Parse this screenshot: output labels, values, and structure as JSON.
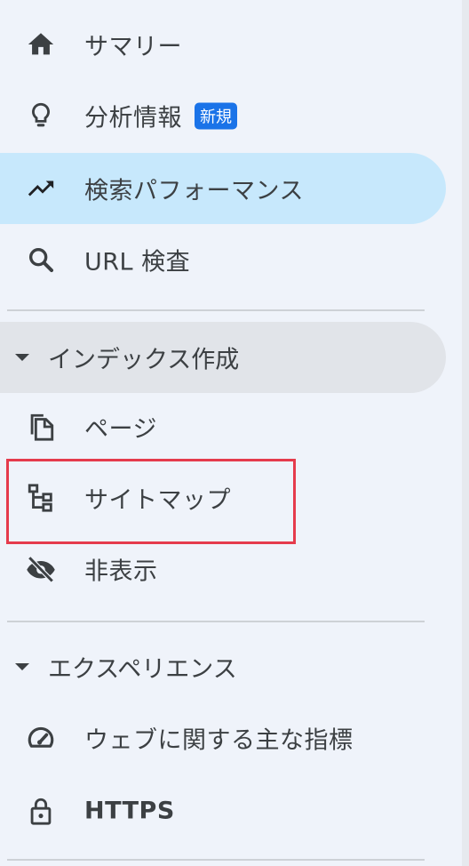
{
  "nav": {
    "summary": {
      "label": "サマリー",
      "icon": "home-icon"
    },
    "insights": {
      "label": "分析情報",
      "badge": "新規",
      "icon": "lightbulb-icon"
    },
    "performance": {
      "label": "検索パフォーマンス",
      "icon": "trending-up-icon"
    },
    "url_inspection": {
      "label": "URL 検査",
      "icon": "search-icon"
    }
  },
  "indexing": {
    "section_label": "インデックス作成",
    "pages": {
      "label": "ページ",
      "icon": "copy-pages-icon"
    },
    "sitemaps": {
      "label": "サイトマップ",
      "icon": "sitemap-icon"
    },
    "removals": {
      "label": "非表示",
      "icon": "eye-off-icon"
    }
  },
  "experience": {
    "section_label": "エクスペリエンス",
    "core_web_vitals": {
      "label": "ウェブに関する主な指標",
      "icon": "speedometer-icon"
    },
    "https": {
      "label": "HTTPS",
      "icon": "lock-icon"
    }
  },
  "colors": {
    "background": "#eff3fa",
    "selected": "#c7e8fc",
    "section_bg": "#e1e4e9",
    "badge": "#1a73e8",
    "highlight": "#e53b4c"
  }
}
